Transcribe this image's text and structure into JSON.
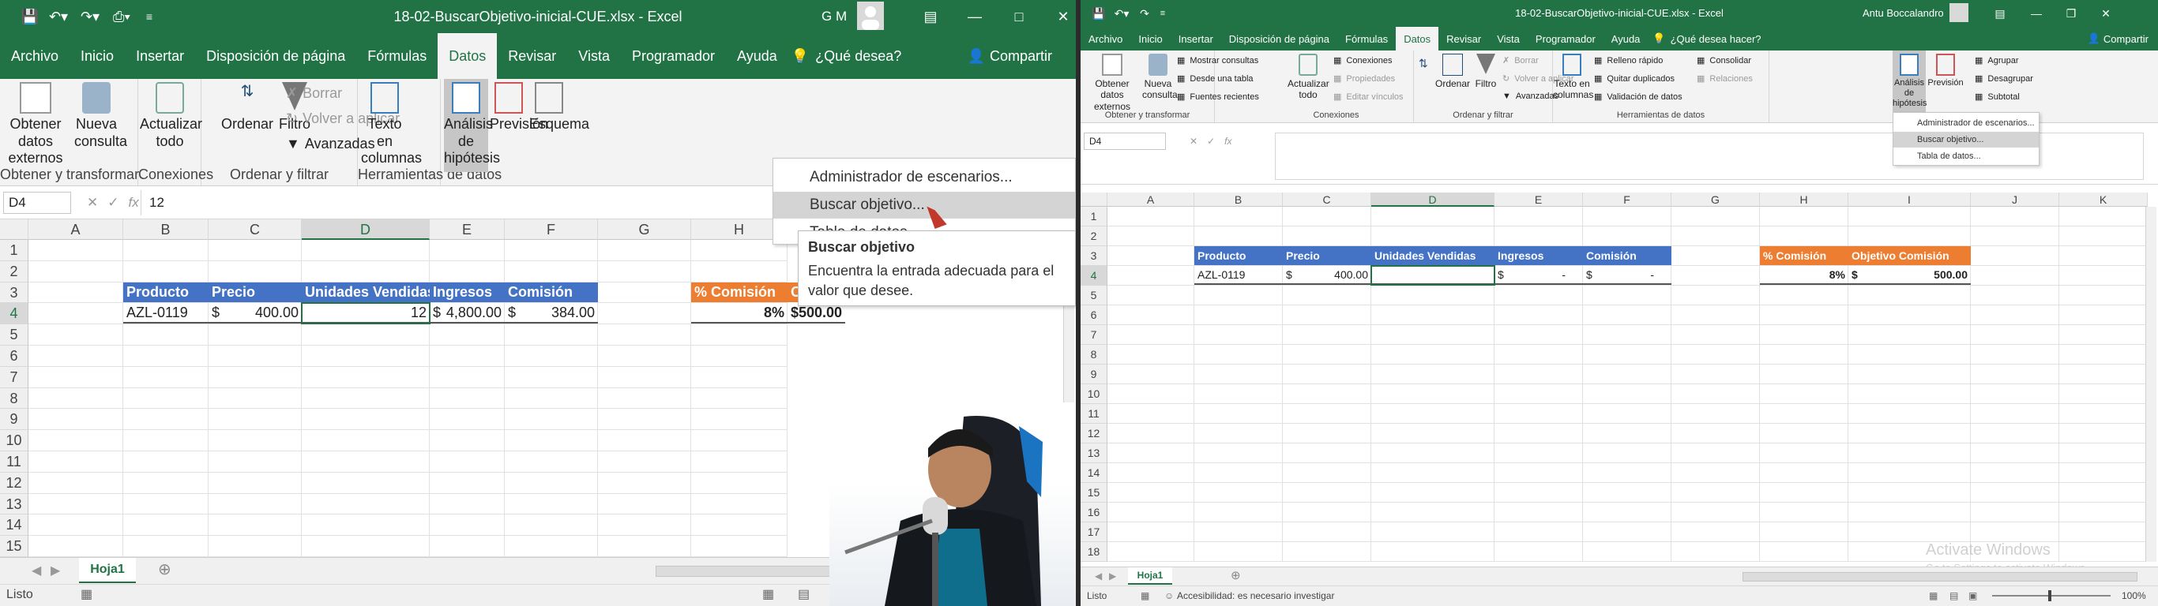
{
  "left": {
    "window_title": "18-02-BuscarObjetivo-inicial-CUE.xlsx  -  Excel",
    "user_initials": "G M",
    "tabs": [
      "Archivo",
      "Inicio",
      "Insertar",
      "Disposición de página",
      "Fórmulas",
      "Datos",
      "Revisar",
      "Vista",
      "Programador",
      "Ayuda"
    ],
    "active_tab": "Datos",
    "tell_me": "¿Qué desea?",
    "share": "Compartir",
    "ribbon": {
      "obtener_datos_externos": "Obtener datos externos",
      "nueva_consulta": "Nueva consulta",
      "grp_obtener": "Obtener y transformar",
      "actualizar_todo": "Actualizar todo",
      "grp_conexiones": "Conexiones",
      "ordenar": "Ordenar",
      "filtro": "Filtro",
      "borrar": "Borrar",
      "volver_aplicar": "Volver a aplicar",
      "avanzadas": "Avanzadas",
      "grp_ordenar": "Ordenar y filtrar",
      "texto_columnas": "Texto en columnas",
      "grp_herramientas": "Herramientas de datos",
      "analisis": "Análisis de hipótesis",
      "prevision": "Previsión",
      "esquema": "Esquema"
    },
    "name_box": "D4",
    "formula": "12",
    "columns": [
      "A",
      "B",
      "C",
      "D",
      "E",
      "F",
      "G",
      "H"
    ],
    "rows": [
      "1",
      "2",
      "3",
      "4",
      "5",
      "6",
      "7",
      "8",
      "9",
      "10",
      "11",
      "12",
      "13",
      "14",
      "15"
    ],
    "headers": {
      "producto": "Producto",
      "precio": "Precio",
      "unidades": "Unidades Vendidas",
      "ingresos": "Ingresos",
      "comision": "Comisión",
      "pct": "% Comisión",
      "objetivo": "Objetivo Comisión"
    },
    "row4": {
      "producto": "AZL-0119",
      "precio_sym": "$",
      "precio": "400.00",
      "unidades": "12",
      "ingresos_sym": "$",
      "ingresos": "4,800.00",
      "comision_sym": "$",
      "comision": "384.00",
      "pct": "8%",
      "obj_sym": "$",
      "obj": "500.00"
    },
    "menu": [
      "Administrador de escenarios...",
      "Buscar objetivo...",
      "Tabla de datos..."
    ],
    "tooltip_title": "Buscar objetivo",
    "tooltip_text": "Encuentra la entrada adecuada para el valor que desee.",
    "sheet_tab": "Hoja1",
    "status": "Listo"
  },
  "right": {
    "window_title": "18-02-BuscarObjetivo-inicial-CUE.xlsx  -  Excel",
    "user_name": "Antu Boccalandro",
    "tabs": [
      "Archivo",
      "Inicio",
      "Insertar",
      "Disposición de página",
      "Fórmulas",
      "Datos",
      "Revisar",
      "Vista",
      "Programador",
      "Ayuda"
    ],
    "active_tab": "Datos",
    "tell_me": "¿Qué desea hacer?",
    "share": "Compartir",
    "ribbon": {
      "obtener_datos_externos": "Obtener datos externos",
      "nueva_consulta": "Nueva consulta",
      "mostrar_consultas": "Mostrar consultas",
      "desde_tabla": "Desde una tabla",
      "fuentes_recientes": "Fuentes recientes",
      "grp_obtener": "Obtener y transformar",
      "actualizar_todo": "Actualizar todo",
      "conexiones": "Conexiones",
      "propiedades": "Propiedades",
      "editar_vinculos": "Editar vínculos",
      "grp_conexiones": "Conexiones",
      "ordenar": "Ordenar",
      "filtro": "Filtro",
      "borrar": "Borrar",
      "volver_aplicar": "Volver a aplicar",
      "avanzadas": "Avanzadas",
      "grp_ordenar": "Ordenar y filtrar",
      "texto_columnas": "Texto en columnas",
      "relleno_rapido": "Relleno rápido",
      "quitar_duplicados": "Quitar duplicados",
      "validacion": "Validación de datos",
      "consolidar": "Consolidar",
      "relaciones": "Relaciones",
      "grp_herramientas": "Herramientas de datos",
      "analisis": "Análisis de hipótesis",
      "prevision": "Previsión",
      "agrupar": "Agrupar",
      "desagrupar": "Desagrupar",
      "subtotal": "Subtotal"
    },
    "name_box": "D4",
    "columns": [
      "A",
      "B",
      "C",
      "D",
      "E",
      "F",
      "G",
      "H",
      "I",
      "J",
      "K"
    ],
    "rows": [
      "1",
      "2",
      "3",
      "4",
      "5",
      "6",
      "7",
      "8",
      "9",
      "10",
      "11",
      "12",
      "13",
      "14",
      "15",
      "16",
      "17",
      "18"
    ],
    "headers": {
      "producto": "Producto",
      "precio": "Precio",
      "unidades": "Unidades Vendidas",
      "ingresos": "Ingresos",
      "comision": "Comisión",
      "pct": "% Comisión",
      "objetivo": "Objetivo Comisión"
    },
    "row4": {
      "producto": "AZL-0119",
      "precio_sym": "$",
      "precio": "400.00",
      "ingresos_sym": "$",
      "ingresos": "-",
      "comision_sym": "$",
      "comision": "-",
      "pct": "8%",
      "obj_sym": "$",
      "obj": "500.00"
    },
    "menu": [
      "Administrador de escenarios...",
      "Buscar objetivo...",
      "Tabla de datos..."
    ],
    "sheet_tab": "Hoja1",
    "status": "Listo",
    "accessibility": "Accesibilidad: es necesario investigar",
    "zoom": "100%",
    "watermark_title": "Activate Windows",
    "watermark_sub": "Go to Settings to activate Windows."
  },
  "colors": {
    "excel_green": "#217346",
    "table_header_blue": "#4472c4",
    "table_header_orange": "#ed7d31"
  }
}
